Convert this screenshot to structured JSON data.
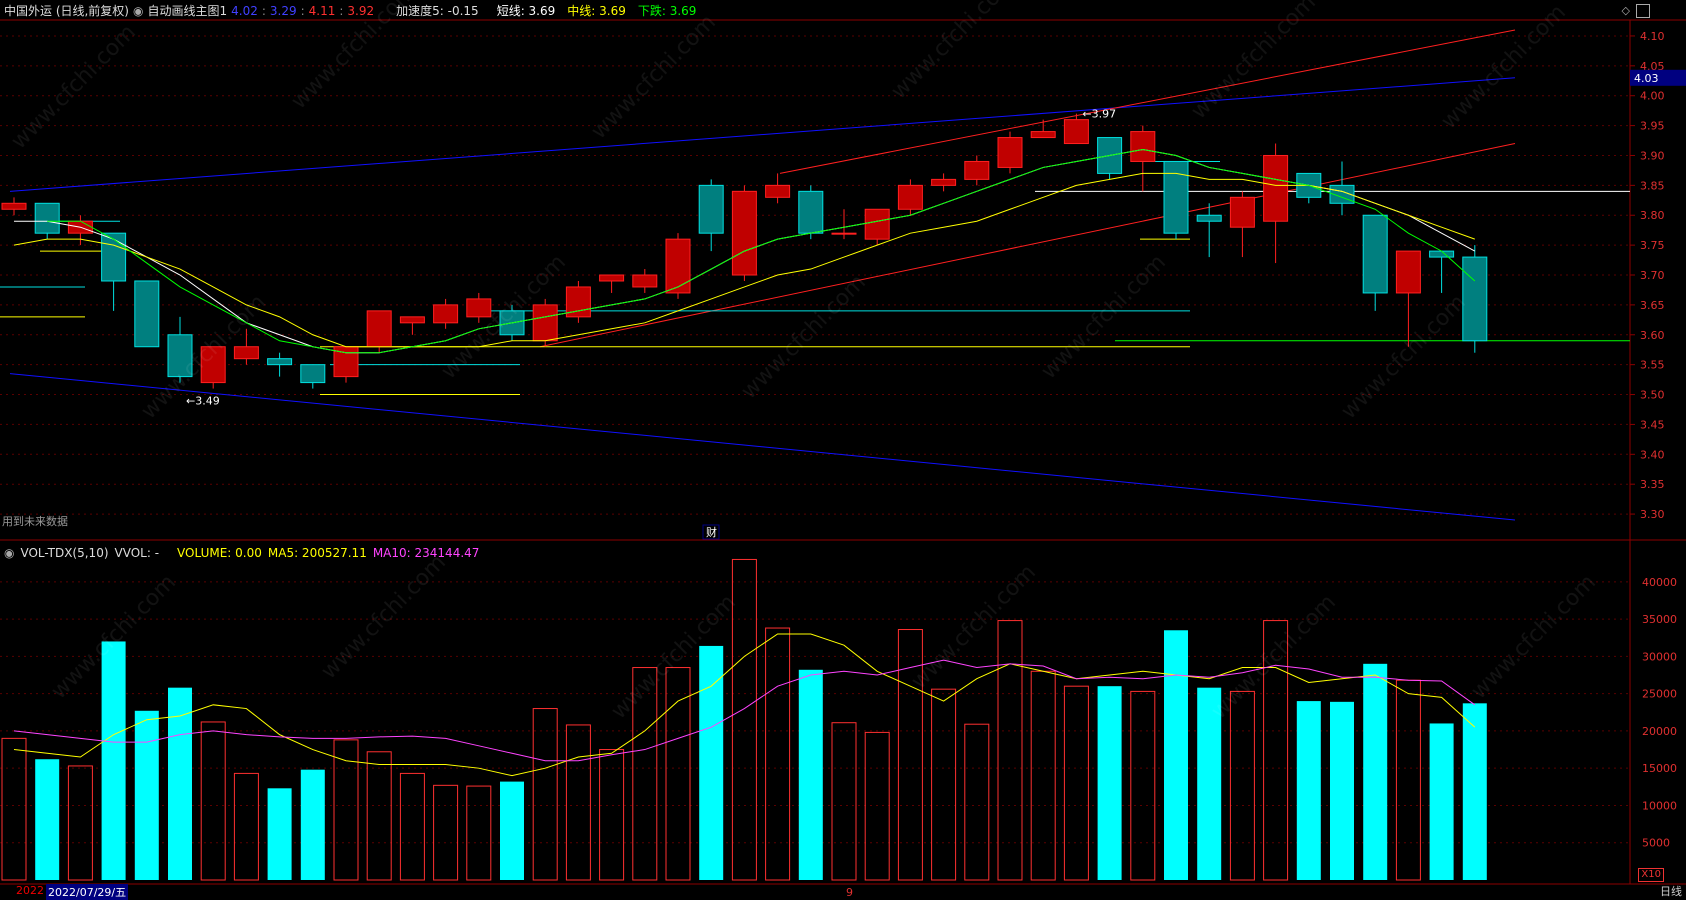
{
  "header": {
    "stock": "中国外运 (日线,前复权)",
    "indicator_name": "自动画线主图1",
    "val1": "4.02",
    "val2": "3.29",
    "val3": "4.11",
    "val4": "3.92",
    "accel_label": "加速度5: -0.15",
    "short_label": "短线: 3.69",
    "mid_label": "中线: 3.69",
    "down_label": "下跌: 3.69"
  },
  "volume_header": {
    "name": "VOL-TDX(5,10)",
    "vvol": "VVOL: -",
    "volume": "VOLUME: 0.00",
    "ma5": "MA5: 200527.11",
    "ma10": "MA10: 234144.47"
  },
  "note_future": "用到未来数据",
  "cai_label": "财",
  "bottom": {
    "left_cut": "2022",
    "date": "2022/07/29/五",
    "month_mark": "9",
    "period": "日线",
    "x10": "X10"
  },
  "annotations": {
    "low": "3.49",
    "high": "3.97",
    "current_price_tag": "4.03"
  },
  "colors": {
    "up": "#ff2020",
    "down": "#00e0e0",
    "ma_short": "#ffffff",
    "ma_mid": "#ffff00",
    "ma_green": "#00ff00",
    "ma5_vol": "#ffff00",
    "ma10_vol": "#ff44ff",
    "channel_blue": "#1010ff",
    "channel_red": "#ff2020"
  },
  "watermark": "www.cfchi.com",
  "chart_data": {
    "type": "candlestick",
    "price_axis": {
      "ticks": [
        4.1,
        4.05,
        4.0,
        3.95,
        3.9,
        3.85,
        3.8,
        3.75,
        3.7,
        3.65,
        3.6,
        3.55,
        3.5,
        3.45,
        3.4,
        3.35,
        3.3
      ],
      "ylim": [
        3.27,
        4.12
      ]
    },
    "volume_axis": {
      "ticks": [
        40000,
        35000,
        30000,
        25000,
        20000,
        15000,
        10000,
        5000
      ],
      "ylim": [
        0,
        44000
      ]
    },
    "candles": [
      {
        "o": 3.81,
        "c": 3.82,
        "h": 3.83,
        "l": 3.8,
        "v": 19000
      },
      {
        "o": 3.82,
        "c": 3.77,
        "h": 3.82,
        "l": 3.76,
        "v": 16200
      },
      {
        "o": 3.77,
        "c": 3.79,
        "h": 3.8,
        "l": 3.75,
        "v": 15300
      },
      {
        "o": 3.77,
        "c": 3.69,
        "h": 3.77,
        "l": 3.64,
        "v": 32000
      },
      {
        "o": 3.69,
        "c": 3.58,
        "h": 3.69,
        "l": 3.58,
        "v": 22700
      },
      {
        "o": 3.6,
        "c": 3.53,
        "h": 3.63,
        "l": 3.52,
        "v": 25800
      },
      {
        "o": 3.52,
        "c": 3.58,
        "h": 3.58,
        "l": 3.51,
        "v": 21200
      },
      {
        "o": 3.56,
        "c": 3.58,
        "h": 3.61,
        "l": 3.55,
        "v": 14300
      },
      {
        "o": 3.56,
        "c": 3.55,
        "h": 3.57,
        "l": 3.53,
        "v": 12300
      },
      {
        "o": 3.55,
        "c": 3.52,
        "h": 3.55,
        "l": 3.51,
        "v": 14800
      },
      {
        "o": 3.53,
        "c": 3.58,
        "h": 3.58,
        "l": 3.52,
        "v": 18800
      },
      {
        "o": 3.58,
        "c": 3.64,
        "h": 3.64,
        "l": 3.57,
        "v": 17200
      },
      {
        "o": 3.62,
        "c": 3.63,
        "h": 3.63,
        "l": 3.6,
        "v": 14300
      },
      {
        "o": 3.62,
        "c": 3.65,
        "h": 3.66,
        "l": 3.61,
        "v": 12700
      },
      {
        "o": 3.63,
        "c": 3.66,
        "h": 3.67,
        "l": 3.62,
        "v": 12600
      },
      {
        "o": 3.64,
        "c": 3.6,
        "h": 3.65,
        "l": 3.59,
        "v": 13200
      },
      {
        "o": 3.59,
        "c": 3.65,
        "h": 3.66,
        "l": 3.58,
        "v": 23000
      },
      {
        "o": 3.63,
        "c": 3.68,
        "h": 3.69,
        "l": 3.62,
        "v": 20800
      },
      {
        "o": 3.69,
        "c": 3.7,
        "h": 3.7,
        "l": 3.67,
        "v": 17500
      },
      {
        "o": 3.68,
        "c": 3.7,
        "h": 3.71,
        "l": 3.67,
        "v": 28500
      },
      {
        "o": 3.67,
        "c": 3.76,
        "h": 3.77,
        "l": 3.66,
        "v": 28500
      },
      {
        "o": 3.85,
        "c": 3.77,
        "h": 3.86,
        "l": 3.74,
        "v": 31400
      },
      {
        "o": 3.7,
        "c": 3.84,
        "h": 3.85,
        "l": 3.69,
        "v": 43000
      },
      {
        "o": 3.83,
        "c": 3.85,
        "h": 3.87,
        "l": 3.82,
        "v": 33800
      },
      {
        "o": 3.84,
        "c": 3.77,
        "h": 3.85,
        "l": 3.76,
        "v": 28200
      },
      {
        "o": 3.77,
        "c": 3.77,
        "h": 3.81,
        "l": 3.76,
        "v": 21100
      },
      {
        "o": 3.76,
        "c": 3.81,
        "h": 3.81,
        "l": 3.75,
        "v": 19800
      },
      {
        "o": 3.81,
        "c": 3.85,
        "h": 3.86,
        "l": 3.8,
        "v": 33600
      },
      {
        "o": 3.85,
        "c": 3.86,
        "h": 3.87,
        "l": 3.84,
        "v": 25600
      },
      {
        "o": 3.86,
        "c": 3.89,
        "h": 3.9,
        "l": 3.85,
        "v": 20900
      },
      {
        "o": 3.88,
        "c": 3.93,
        "h": 3.94,
        "l": 3.87,
        "v": 34800
      },
      {
        "o": 3.93,
        "c": 3.94,
        "h": 3.96,
        "l": 3.93,
        "v": 28000
      },
      {
        "o": 3.92,
        "c": 3.96,
        "h": 3.97,
        "l": 3.92,
        "v": 26000
      },
      {
        "o": 3.93,
        "c": 3.87,
        "h": 3.93,
        "l": 3.86,
        "v": 26000
      },
      {
        "o": 3.89,
        "c": 3.94,
        "h": 3.95,
        "l": 3.84,
        "v": 25300
      },
      {
        "o": 3.89,
        "c": 3.77,
        "h": 3.89,
        "l": 3.76,
        "v": 33500
      },
      {
        "o": 3.8,
        "c": 3.79,
        "h": 3.82,
        "l": 3.73,
        "v": 25800
      },
      {
        "o": 3.78,
        "c": 3.83,
        "h": 3.84,
        "l": 3.73,
        "v": 25300
      },
      {
        "o": 3.79,
        "c": 3.9,
        "h": 3.92,
        "l": 3.72,
        "v": 34800
      },
      {
        "o": 3.87,
        "c": 3.83,
        "h": 3.87,
        "l": 3.82,
        "v": 24000
      },
      {
        "o": 3.85,
        "c": 3.82,
        "h": 3.89,
        "l": 3.8,
        "v": 23900
      },
      {
        "o": 3.8,
        "c": 3.67,
        "h": 3.8,
        "l": 3.64,
        "v": 29000
      },
      {
        "o": 3.67,
        "c": 3.74,
        "h": 3.74,
        "l": 3.58,
        "v": 26800
      },
      {
        "o": 3.74,
        "c": 3.73,
        "h": 3.74,
        "l": 3.67,
        "v": 21000
      },
      {
        "o": 3.73,
        "c": 3.59,
        "h": 3.75,
        "l": 3.57,
        "v": 23700
      }
    ],
    "ma_short": [
      3.79,
      3.79,
      3.78,
      3.76,
      3.73,
      3.7,
      3.66,
      3.62,
      3.6,
      3.58,
      3.57,
      3.57,
      3.58,
      3.59,
      3.61,
      3.62,
      3.63,
      3.64,
      3.65,
      3.66,
      3.68,
      3.71,
      3.74,
      3.76,
      3.77,
      3.78,
      3.79,
      3.8,
      3.82,
      3.84,
      3.86,
      3.88,
      3.89,
      3.9,
      3.91,
      3.9,
      3.88,
      3.87,
      3.86,
      3.85,
      3.84,
      3.82,
      3.8,
      3.77,
      3.74
    ],
    "ma_mid": [
      3.75,
      3.76,
      3.76,
      3.75,
      3.73,
      3.71,
      3.68,
      3.65,
      3.63,
      3.6,
      3.58,
      3.58,
      3.58,
      3.58,
      3.58,
      3.59,
      3.59,
      3.6,
      3.61,
      3.62,
      3.64,
      3.66,
      3.68,
      3.7,
      3.71,
      3.73,
      3.75,
      3.77,
      3.78,
      3.79,
      3.81,
      3.83,
      3.85,
      3.86,
      3.87,
      3.87,
      3.86,
      3.86,
      3.85,
      3.85,
      3.84,
      3.82,
      3.8,
      3.78,
      3.76
    ],
    "ma_green": [
      null,
      3.79,
      3.79,
      3.76,
      3.72,
      3.68,
      3.65,
      3.62,
      3.59,
      3.58,
      3.57,
      3.57,
      3.58,
      3.59,
      3.61,
      3.62,
      3.63,
      3.64,
      3.65,
      3.66,
      3.68,
      3.71,
      3.74,
      3.76,
      3.77,
      3.78,
      3.79,
      3.8,
      3.82,
      3.84,
      3.86,
      3.88,
      3.89,
      3.9,
      3.91,
      3.9,
      3.88,
      3.87,
      3.86,
      3.85,
      3.83,
      3.81,
      3.77,
      3.74,
      3.69
    ],
    "vol_ma5": [
      17500,
      17000,
      16500,
      19500,
      21500,
      22000,
      23500,
      23000,
      19500,
      17500,
      16000,
      15500,
      15500,
      15500,
      15000,
      14000,
      15000,
      16500,
      17000,
      20000,
      24000,
      26000,
      30000,
      33000,
      33000,
      31500,
      28000,
      26000,
      24000,
      27000,
      29000,
      28000,
      27000,
      27500,
      28000,
      27500,
      27000,
      28500,
      28500,
      26500,
      27000,
      27500,
      25000,
      24500,
      20500
    ],
    "vol_ma10": [
      20000,
      19500,
      19000,
      18500,
      18500,
      19500,
      20000,
      19500,
      19200,
      19000,
      19000,
      19200,
      19300,
      19000,
      18000,
      17000,
      16000,
      16000,
      16800,
      17500,
      19000,
      20500,
      23000,
      26000,
      27500,
      28000,
      27500,
      28500,
      29500,
      28500,
      29000,
      28700,
      27000,
      27200,
      27000,
      27500,
      27200,
      27800,
      28800,
      28300,
      27200,
      27200,
      26800,
      26700,
      23500
    ]
  }
}
